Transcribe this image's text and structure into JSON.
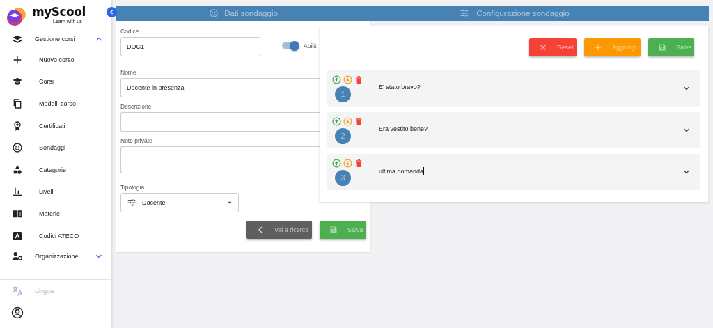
{
  "sidebar": {
    "logo": {
      "name": "myScool",
      "tagline": "Learn with us"
    },
    "items": [
      {
        "label": "Gestione corsi",
        "expanded": true,
        "children": [
          {
            "label": "Nuovo corso"
          },
          {
            "label": "Corsi"
          },
          {
            "label": "Modelli corso"
          },
          {
            "label": "Certificati"
          },
          {
            "label": "Sondaggi"
          },
          {
            "label": "Categorie"
          },
          {
            "label": "Livelli"
          },
          {
            "label": "Materie"
          },
          {
            "label": "Codici ATECO"
          }
        ]
      },
      {
        "label": "Organizzazione",
        "expanded": false
      }
    ],
    "footer": {
      "language": {
        "label": "Lingua",
        "disabled": true
      }
    }
  },
  "survey_data": {
    "title": "Dati sondaggio",
    "fields": [
      {
        "label": "Codice",
        "value": "DOC1",
        "kind": "short"
      },
      {
        "label": "Nome",
        "value": "Docente in presenza",
        "kind": "wide"
      },
      {
        "label": "Descrizione",
        "kind": "wide"
      },
      {
        "label": "Note private",
        "kind": "tall"
      }
    ],
    "toggle": {
      "label": "Abilit",
      "on": true
    },
    "type_select": {
      "label": "Tipologia",
      "value": "Docente"
    },
    "buttons": [
      {
        "label": "Vai a ricerca",
        "kind": "back"
      },
      {
        "label": "Salva",
        "kind": "save"
      }
    ]
  },
  "survey_config": {
    "title": "Configurazione sondaggio",
    "buttons": [
      {
        "label": "Reset",
        "kind": "reset"
      },
      {
        "label": "Aggiungi",
        "kind": "add"
      },
      {
        "label": "Salva",
        "kind": "save"
      }
    ],
    "questions": [
      {
        "number": "1",
        "text": "E' stato bravo?",
        "editing": false,
        "expanded": false
      },
      {
        "number": "2",
        "text": "Era vestito bene?",
        "editing": false,
        "expanded": false
      },
      {
        "number": "3",
        "text": "ultima domanda",
        "editing": true,
        "expanded": false
      }
    ]
  }
}
